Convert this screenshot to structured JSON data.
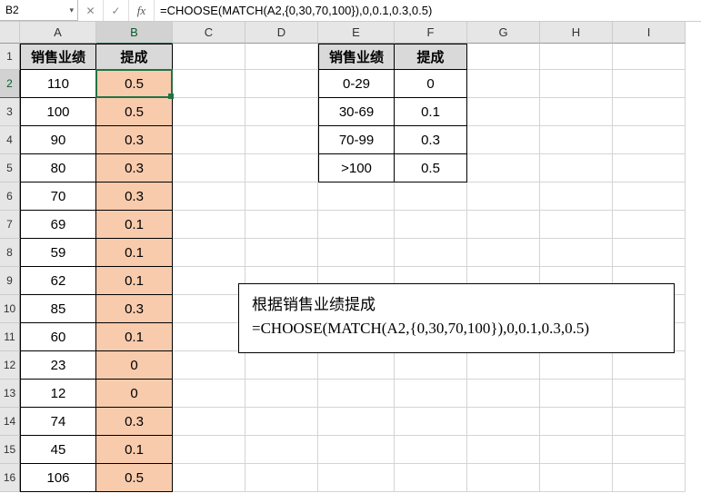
{
  "namebox": "B2",
  "formula": "=CHOOSE(MATCH(A2,{0,30,70,100}),0,0.1,0.3,0.5)",
  "columns": [
    "A",
    "B",
    "C",
    "D",
    "E",
    "F",
    "G",
    "H",
    "I"
  ],
  "rows": [
    "1",
    "2",
    "3",
    "4",
    "5",
    "6",
    "7",
    "8",
    "9",
    "10",
    "11",
    "12",
    "13",
    "14",
    "15",
    "16"
  ],
  "mainHeaders": {
    "a": "销售业绩",
    "b": "提成"
  },
  "mainData": [
    {
      "a": "110",
      "b": "0.5"
    },
    {
      "a": "100",
      "b": "0.5"
    },
    {
      "a": "90",
      "b": "0.3"
    },
    {
      "a": "80",
      "b": "0.3"
    },
    {
      "a": "70",
      "b": "0.3"
    },
    {
      "a": "69",
      "b": "0.1"
    },
    {
      "a": "59",
      "b": "0.1"
    },
    {
      "a": "62",
      "b": "0.1"
    },
    {
      "a": "85",
      "b": "0.3"
    },
    {
      "a": "60",
      "b": "0.1"
    },
    {
      "a": "23",
      "b": "0"
    },
    {
      "a": "12",
      "b": "0"
    },
    {
      "a": "74",
      "b": "0.3"
    },
    {
      "a": "45",
      "b": "0.1"
    },
    {
      "a": "106",
      "b": "0.5"
    }
  ],
  "lookupHeaders": {
    "e": "销售业绩",
    "f": "提成"
  },
  "lookupData": [
    {
      "e": "0-29",
      "f": "0"
    },
    {
      "e": "30-69",
      "f": "0.1"
    },
    {
      "e": "70-99",
      "f": "0.3"
    },
    {
      "e": ">100",
      "f": "0.5"
    }
  ],
  "callout": {
    "line1": "根据销售业绩提成",
    "line2": "=CHOOSE(MATCH(A2,{0,30,70,100}),0,0.1,0.3,0.5)"
  },
  "icons": {
    "cancel": "✕",
    "enter": "✓",
    "dropdown": "▾",
    "fx": "fx"
  }
}
